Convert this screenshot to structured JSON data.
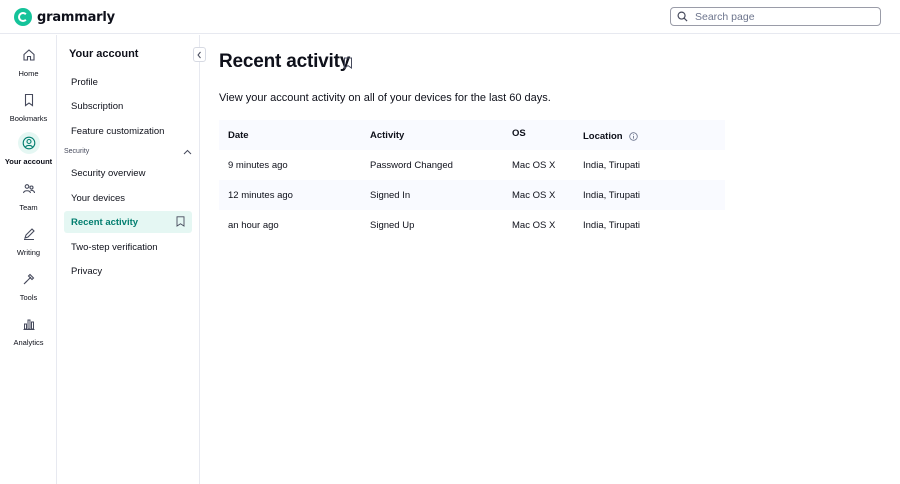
{
  "app": {
    "name": "grammarly"
  },
  "search": {
    "placeholder": "Search page",
    "value": ""
  },
  "rail": {
    "items": [
      {
        "label": "Home",
        "icon": "home-icon"
      },
      {
        "label": "Bookmarks",
        "icon": "bookmark-icon"
      },
      {
        "label": "Your account",
        "icon": "user-icon",
        "active": true
      },
      {
        "label": "Team",
        "icon": "team-icon"
      },
      {
        "label": "Writing",
        "icon": "pen-icon"
      },
      {
        "label": "Tools",
        "icon": "tools-icon"
      },
      {
        "label": "Analytics",
        "icon": "analytics-icon"
      }
    ]
  },
  "subnav": {
    "title": "Your account",
    "items": [
      {
        "label": "Profile"
      },
      {
        "label": "Subscription"
      },
      {
        "label": "Feature customization"
      }
    ],
    "section": {
      "label": "Security",
      "items": [
        {
          "label": "Security overview"
        },
        {
          "label": "Your devices"
        },
        {
          "label": "Recent activity",
          "active": true
        },
        {
          "label": "Two-step verification"
        },
        {
          "label": "Privacy"
        }
      ]
    }
  },
  "main": {
    "title": "Recent activity",
    "subtitle": "View your account activity on all of your devices for the last 60 days.",
    "table": {
      "headers": [
        "Date",
        "Activity",
        "OS",
        "Location"
      ],
      "rows": [
        [
          "9 minutes ago",
          "Password Changed",
          "Mac OS X",
          "India, Tirupati"
        ],
        [
          "12 minutes ago",
          "Signed In",
          "Mac OS X",
          "India, Tirupati"
        ],
        [
          "an hour ago",
          "Signed Up",
          "Mac OS X",
          "India, Tirupati"
        ]
      ]
    }
  },
  "colors": {
    "brand": "#15c39a",
    "active_bg": "#e5f7f3",
    "active_text": "#027e6f"
  }
}
